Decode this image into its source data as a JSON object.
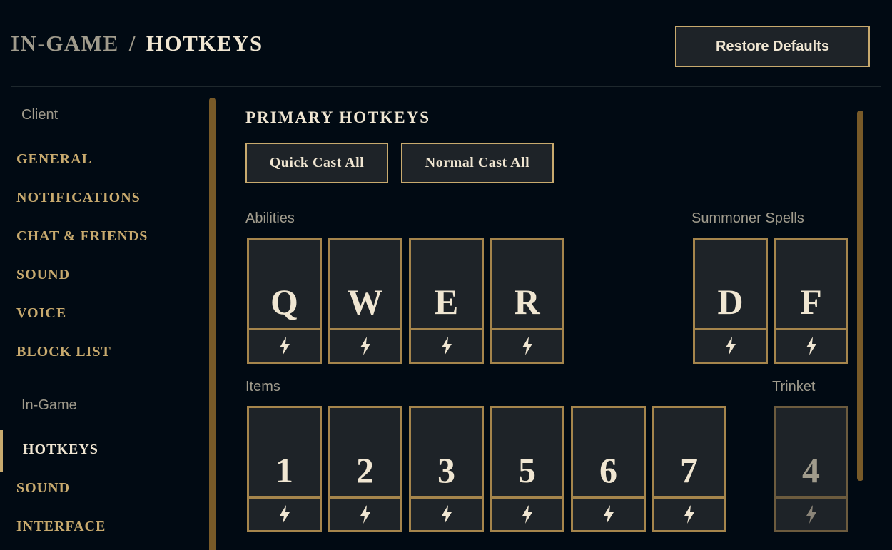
{
  "header": {
    "breadcrumb_parent": "IN-GAME",
    "breadcrumb_separator": "/",
    "breadcrumb_current": "HOTKEYS",
    "restore_label": "Restore Defaults"
  },
  "sidebar": {
    "client_label": "Client",
    "client_items": [
      "GENERAL",
      "NOTIFICATIONS",
      "CHAT & FRIENDS",
      "SOUND",
      "VOICE",
      "BLOCK LIST"
    ],
    "ingame_label": "In-Game",
    "ingame_items": [
      "HOTKEYS",
      "SOUND",
      "INTERFACE"
    ]
  },
  "main": {
    "title": "PRIMARY HOTKEYS",
    "quick_cast_label": "Quick Cast All",
    "normal_cast_label": "Normal Cast All",
    "abilities_label": "Abilities",
    "summoner_label": "Summoner Spells",
    "items_label": "Items",
    "trinket_label": "Trinket",
    "abilities": [
      "Q",
      "W",
      "E",
      "R"
    ],
    "summoners": [
      "D",
      "F"
    ],
    "items": [
      "1",
      "2",
      "3",
      "5",
      "6",
      "7"
    ],
    "trinket": "4"
  },
  "colors": {
    "background": "#010a13",
    "gold": "#c8aa6e",
    "gold_dark": "#785a28",
    "text_light": "#f0e6d2",
    "text_muted": "#a09b8c",
    "panel": "#1e2328"
  },
  "icons": {
    "cast_mode": "lightning-bolt-icon"
  }
}
